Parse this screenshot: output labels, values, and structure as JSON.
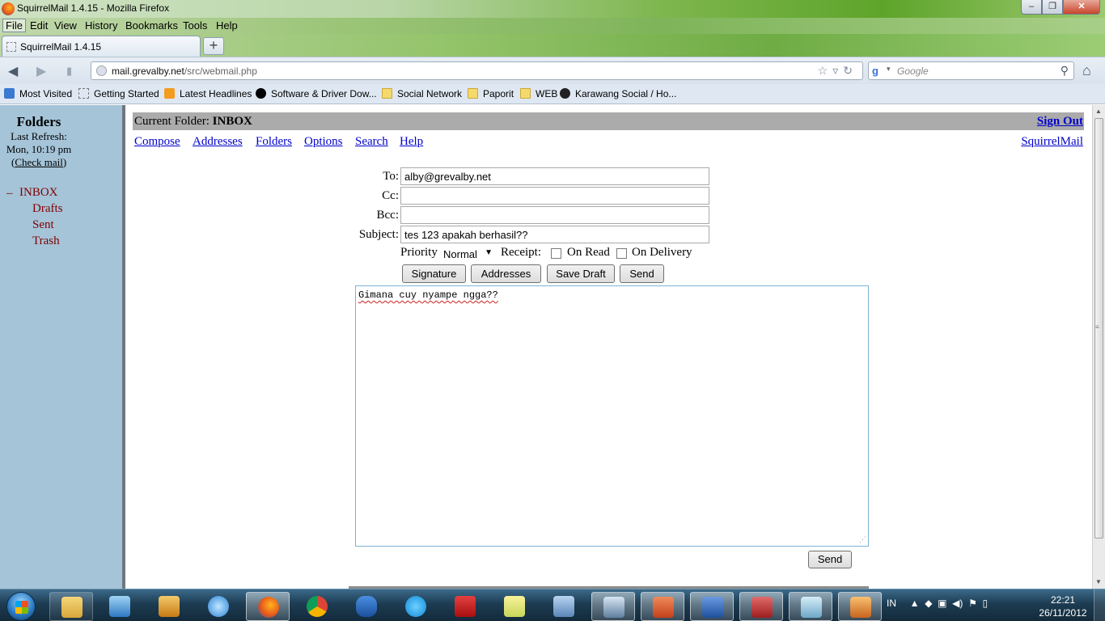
{
  "window": {
    "title": "SquirrelMail 1.4.15 - Mozilla Firefox",
    "min": "–",
    "max": "❐",
    "close": "✕"
  },
  "menu": [
    "File",
    "Edit",
    "View",
    "History",
    "Bookmarks",
    "Tools",
    "Help"
  ],
  "tab": {
    "label": "SquirrelMail 1.4.15",
    "new_tab": "+"
  },
  "nav": {
    "url_host": "mail.grevalby.net",
    "url_path": "/src/webmail.php",
    "search_placeholder": "Google"
  },
  "bookmarks": [
    "Most Visited",
    "Getting Started",
    "Latest Headlines",
    "Software & Driver Dow...",
    "Social Network",
    "Paporit",
    "WEB",
    "Karawang Social / Ho..."
  ],
  "sidebar": {
    "title": "Folders",
    "last_refresh_label": "Last Refresh:",
    "last_refresh_time": "Mon, 10:19 pm",
    "check_mail": "Check mail",
    "folders": [
      "INBOX",
      "Drafts",
      "Sent",
      "Trash"
    ]
  },
  "header": {
    "current_folder_label": "Current Folder:",
    "current_folder": "INBOX",
    "sign_out": "Sign Out",
    "links": [
      "Compose",
      "Addresses",
      "Folders",
      "Options",
      "Search",
      "Help"
    ],
    "brand_link": "SquirrelMail"
  },
  "compose": {
    "to_label": "To:",
    "to_value": "alby@grevalby.net",
    "cc_label": "Cc:",
    "cc_value": "",
    "bcc_label": "Bcc:",
    "bcc_value": "",
    "subject_label": "Subject:",
    "subject_value": "tes 123 apakah berhasil??",
    "priority_label": "Priority",
    "priority_value": "Normal",
    "receipt_label": "Receipt:",
    "on_read": "On Read",
    "on_delivery": "On Delivery",
    "on_read_checked": false,
    "on_delivery_checked": false,
    "buttons": [
      "Signature",
      "Addresses",
      "Save Draft",
      "Send"
    ],
    "body": "Gimana cuy nyampe ngga??",
    "send_bottom": "Send"
  },
  "taskbar": {
    "language": "IN",
    "time": "22:21",
    "date": "26/11/2012"
  }
}
